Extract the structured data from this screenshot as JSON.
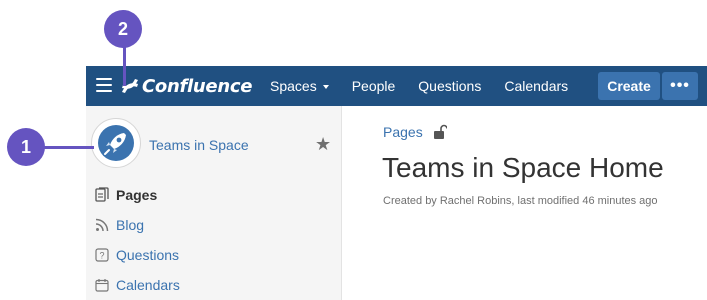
{
  "header": {
    "app_name": "Confluence",
    "nav": [
      "Spaces",
      "People",
      "Questions",
      "Calendars"
    ],
    "create_label": "Create",
    "more_label": "•••"
  },
  "sidebar": {
    "space_name": "Teams in Space",
    "items": [
      {
        "label": "Pages",
        "icon": "pages-icon",
        "active": true
      },
      {
        "label": "Blog",
        "icon": "rss-icon",
        "active": false
      },
      {
        "label": "Questions",
        "icon": "question-icon",
        "active": false
      },
      {
        "label": "Calendars",
        "icon": "calendar-icon",
        "active": false
      }
    ]
  },
  "main": {
    "breadcrumb": "Pages",
    "title": "Teams in Space Home",
    "byline": "Created by Rachel Robins, last modified 46 minutes ago"
  },
  "callouts": {
    "one": "1",
    "two": "2"
  },
  "colors": {
    "header_bg": "#205081",
    "button_bg": "#3b73af",
    "link": "#3b73af",
    "callout": "#6554c0",
    "sidebar_bg": "#f5f5f5"
  }
}
